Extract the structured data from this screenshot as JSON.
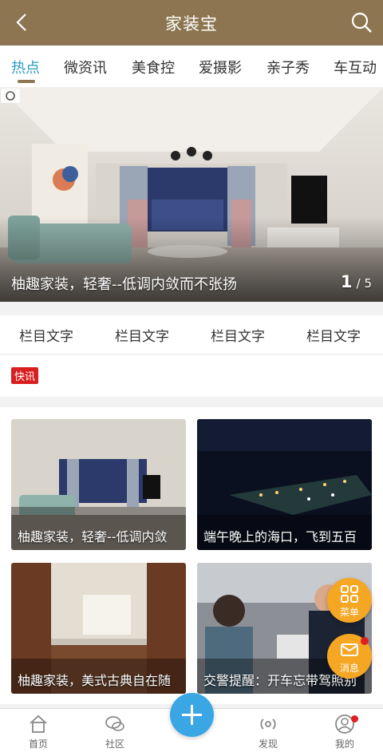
{
  "header": {
    "title": "家装宝",
    "back_icon": "chevron-left-icon",
    "search_icon": "search-icon",
    "bg_color": "#8c7550"
  },
  "tabs": [
    {
      "label": "热点",
      "active": true
    },
    {
      "label": "微资讯",
      "active": false
    },
    {
      "label": "美食控",
      "active": false
    },
    {
      "label": "爱摄影",
      "active": false
    },
    {
      "label": "亲子秀",
      "active": false
    },
    {
      "label": "车互动",
      "active": false
    }
  ],
  "banner": {
    "caption": "柚趣家装，轻奢--低调内敛而不张扬",
    "current": "1",
    "total": "/ 5"
  },
  "columns": [
    "栏目文字",
    "栏目文字",
    "栏目文字",
    "栏目文字"
  ],
  "news": {
    "badge": "快讯"
  },
  "cards": [
    {
      "label": "柚趣家装，轻奢--低调内敛"
    },
    {
      "label": "端午晚上的海口，飞到五百"
    },
    {
      "label": "柚趣家装，美式古典自在随"
    },
    {
      "label": "交警提醒：开车忘带驾照别"
    }
  ],
  "floating": {
    "menu_label": "菜单",
    "message_label": "消息",
    "color": "#f5a623"
  },
  "bottom_nav": {
    "home": "首页",
    "community": "社区",
    "discover": "发现",
    "mine": "我的",
    "plus_color": "#3aa6e4"
  }
}
